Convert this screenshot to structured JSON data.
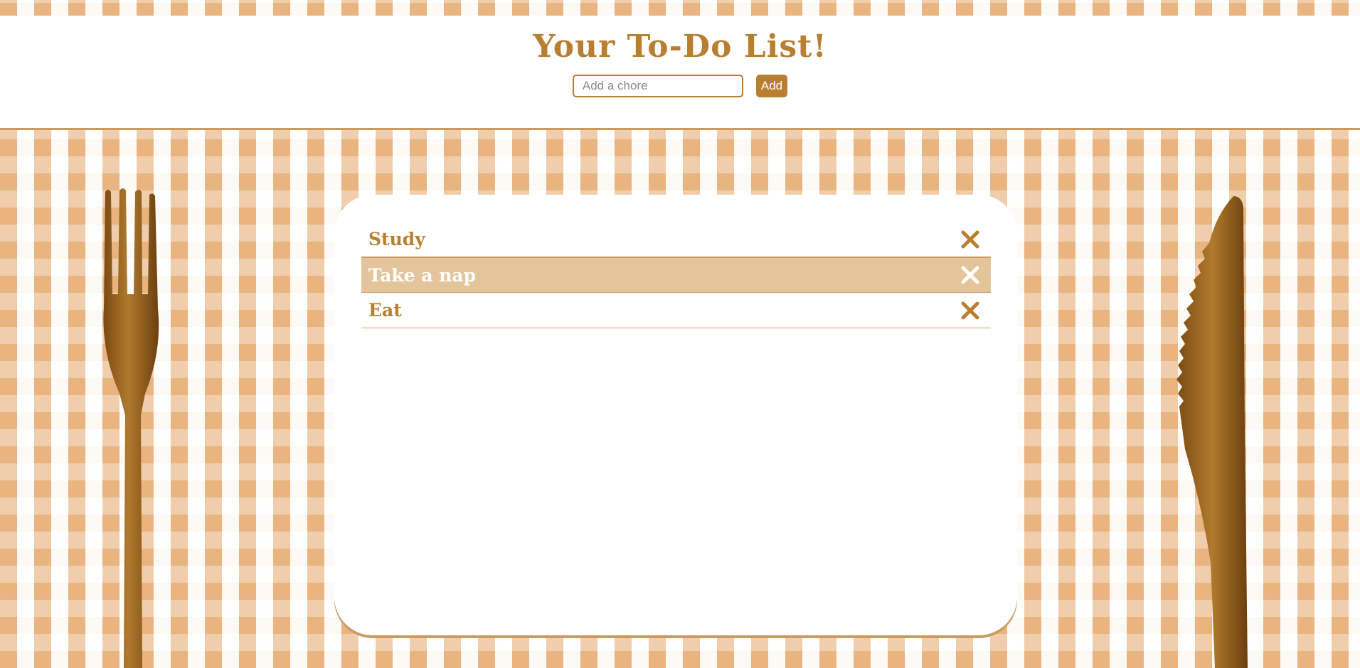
{
  "header": {
    "title": "Your To-Do List!",
    "input_placeholder": "Add a chore",
    "input_value": "",
    "add_label": "Add"
  },
  "todos": [
    {
      "label": "Study",
      "highlighted": false,
      "delete_icon": "close-icon"
    },
    {
      "label": "Take a nap",
      "highlighted": true,
      "delete_icon": "close-icon"
    },
    {
      "label": "Eat",
      "highlighted": false,
      "delete_icon": "close-icon"
    }
  ],
  "colors": {
    "accent": "#b97f31",
    "highlight_row": "#e4c59b",
    "tablecloth": "#e5a86e"
  },
  "decor": {
    "left": "fork",
    "right": "knife"
  }
}
